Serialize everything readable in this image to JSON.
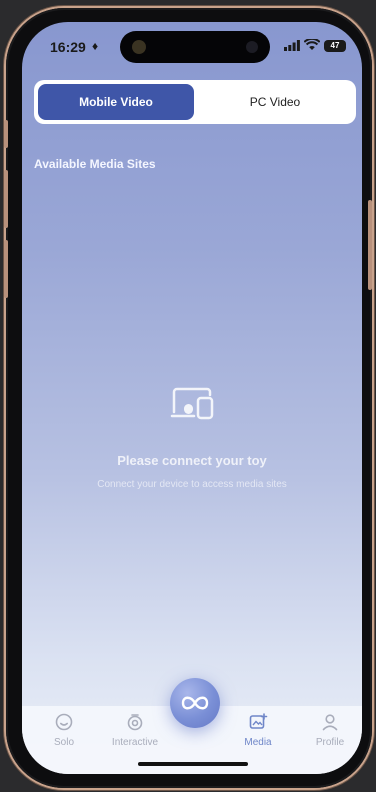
{
  "status_bar": {
    "time": "16:29",
    "battery": "47"
  },
  "segmented_control": {
    "active_label": "Mobile Video",
    "inactive_label": "PC Video"
  },
  "section": {
    "title": "Available Media Sites"
  },
  "empty_state": {
    "title": "Please connect your toy",
    "subtitle": "Connect your device to access media sites",
    "icon": "devices-icon"
  },
  "tab_bar": {
    "tabs": [
      {
        "label": "Solo",
        "icon": "smile-icon",
        "active": false
      },
      {
        "label": "Interactive",
        "icon": "interactive-icon",
        "active": false
      },
      {
        "label": "Media",
        "icon": "media-icon",
        "active": true
      },
      {
        "label": "Profile",
        "icon": "person-icon",
        "active": false
      }
    ],
    "center_button_icon": "infinity-icon"
  },
  "colors": {
    "accent": "#3f56a8",
    "active_tab": "#6f86c8",
    "inactive_tab": "#a9adbb",
    "background_top": "#8897cf",
    "background_bottom": "#ecf0f8"
  }
}
